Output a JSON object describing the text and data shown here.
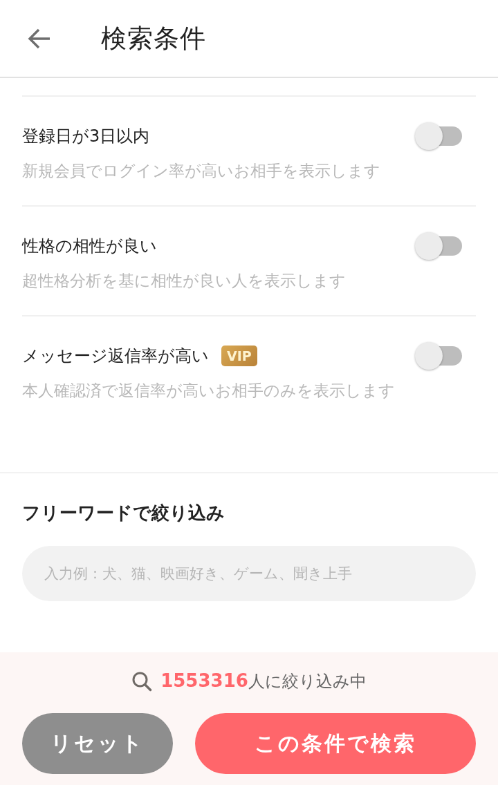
{
  "header": {
    "title": "検索条件"
  },
  "filters": [
    {
      "title": "登録日が3日以内",
      "description": "新規会員でログイン率が高いお相手を表示します",
      "on": false
    },
    {
      "title": "性格の相性が良い",
      "description": "超性格分析を基に相性が良い人を表示します",
      "on": false
    },
    {
      "title": "メッセージ返信率が高い",
      "badge": "VIP",
      "description": "本人確認済で返信率が高いお相手のみを表示します",
      "on": false
    }
  ],
  "free_word": {
    "heading": "フリーワードで絞り込み",
    "placeholder": "入力例：犬、猫、映画好き、ゲーム、聞き上手"
  },
  "footer": {
    "count": "1553316",
    "count_label": "人に絞り込み中",
    "buttons": [
      {
        "label": "リセット",
        "kind": "reset"
      },
      {
        "label": "この条件で検索",
        "kind": "search"
      }
    ]
  }
}
